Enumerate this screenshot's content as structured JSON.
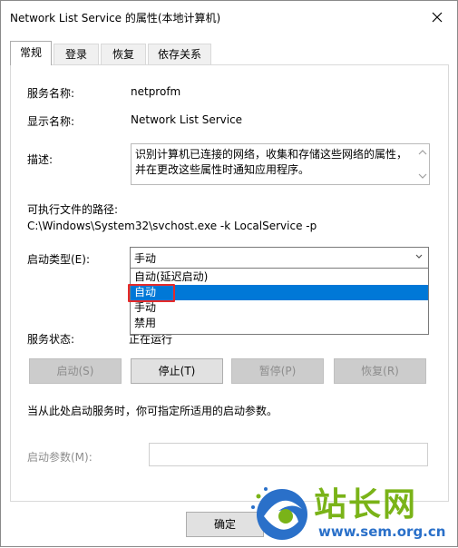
{
  "window": {
    "title": "Network List Service 的属性(本地计算机)"
  },
  "tabs": [
    {
      "label": "常规",
      "active": true
    },
    {
      "label": "登录",
      "active": false
    },
    {
      "label": "恢复",
      "active": false
    },
    {
      "label": "依存关系",
      "active": false
    }
  ],
  "general": {
    "service_name_label": "服务名称:",
    "service_name_value": "netprofm",
    "display_name_label": "显示名称:",
    "display_name_value": "Network List Service",
    "description_label": "描述:",
    "description_value": "识别计算机已连接的网络，收集和存储这些网络的属性，并在更改这些属性时通知应用程序。",
    "exe_path_label": "可执行文件的路径:",
    "exe_path_value": "C:\\Windows\\System32\\svchost.exe -k LocalService -p",
    "startup_type_label": "启动类型(E):",
    "startup_type_value": "手动",
    "startup_options": [
      "自动(延迟启动)",
      "自动",
      "手动",
      "禁用"
    ],
    "startup_highlighted": "自动",
    "service_status_label": "服务状态:",
    "service_status_value": "正在运行",
    "buttons": {
      "start": "启动(S)",
      "stop": "停止(T)",
      "pause": "暂停(P)",
      "resume": "恢复(R)"
    },
    "hint_text": "当从此处启动服务时，你可指定所适用的启动参数。",
    "start_params_label": "启动参数(M):",
    "start_params_value": ""
  },
  "footer": {
    "ok_label": "确定"
  },
  "watermark": {
    "brand_cn": "站长网",
    "url": "www.sem.org.cn"
  },
  "colors": {
    "selection": "#0078d7",
    "highlight_box": "#e52a2a",
    "watermark_green": "#7ab318",
    "watermark_blue": "#2a70c9"
  }
}
